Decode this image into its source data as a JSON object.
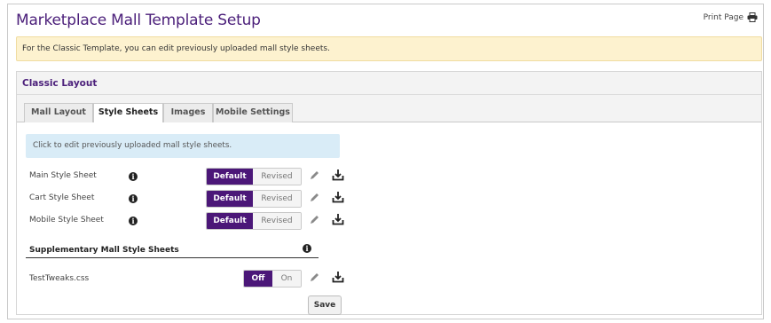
{
  "page": {
    "title": "Marketplace Mall Template Setup",
    "print_label": "Print Page"
  },
  "notice": "For the Classic Template, you can edit previously uploaded mall style sheets.",
  "panel": {
    "title": "Classic Layout",
    "tabs": [
      {
        "label": "Mall Layout",
        "active": false
      },
      {
        "label": "Style Sheets",
        "active": true
      },
      {
        "label": "Images",
        "active": false
      },
      {
        "label": "Mobile Settings",
        "active": false
      }
    ]
  },
  "style_sheets": {
    "info": "Click to edit previously uploaded mall style sheets.",
    "rows": [
      {
        "label": "Main Style Sheet",
        "option_on": "Default",
        "option_off": "Revised"
      },
      {
        "label": "Cart Style Sheet",
        "option_on": "Default",
        "option_off": "Revised"
      },
      {
        "label": "Mobile Style Sheet",
        "option_on": "Default",
        "option_off": "Revised"
      }
    ],
    "supplementary_title": "Supplementary Mall Style Sheets",
    "supplementary": [
      {
        "label": "TestTweaks.css",
        "option_on": "Off",
        "option_off": "On"
      }
    ],
    "save_label": "Save"
  },
  "colors": {
    "brand_purple": "#4b1778",
    "notice_bg": "#fdf2cf",
    "info_bg": "#d9ecf7"
  },
  "icons": [
    "print-icon",
    "info-icon",
    "pencil-icon",
    "download-icon"
  ]
}
